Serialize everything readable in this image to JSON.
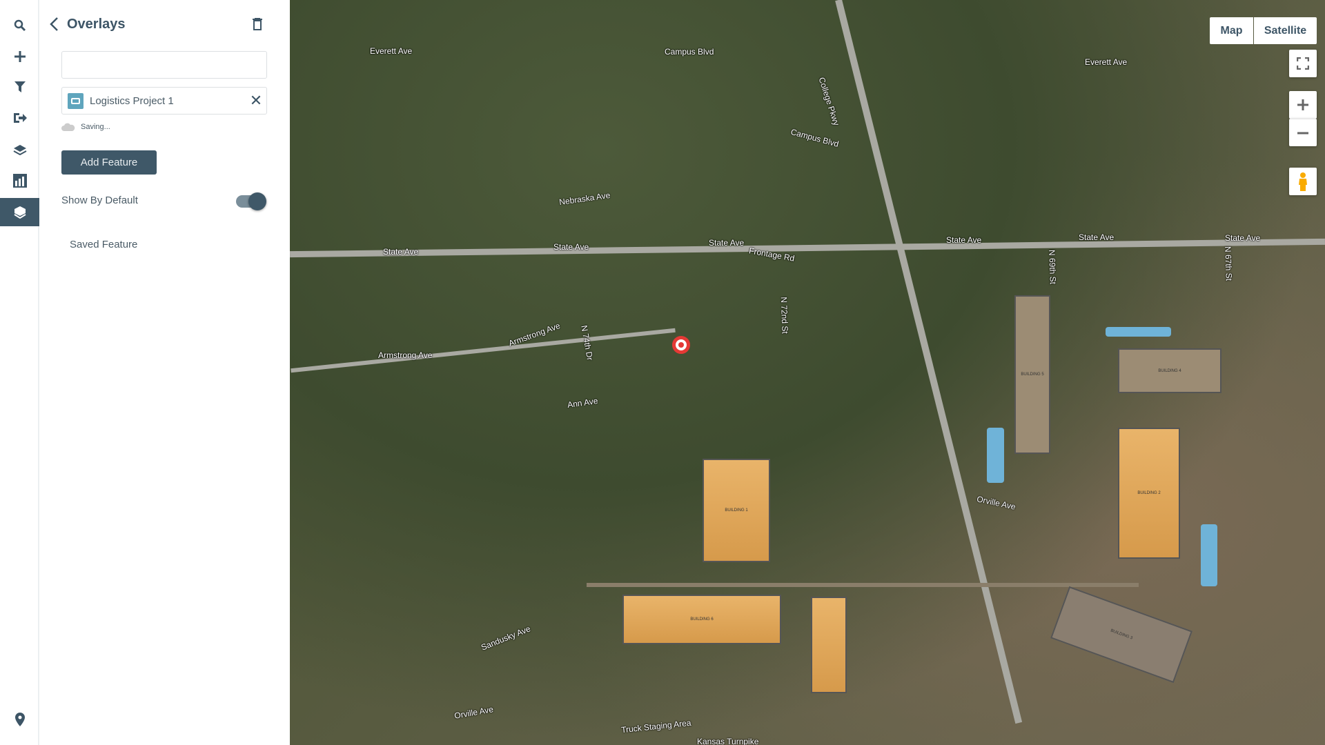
{
  "rail": {
    "items": [
      {
        "icon": "search-icon"
      },
      {
        "icon": "plus-icon"
      },
      {
        "icon": "filter-icon"
      },
      {
        "icon": "export-icon"
      },
      {
        "icon": "layers-icon"
      },
      {
        "icon": "chart-icon"
      },
      {
        "icon": "overlays-icon",
        "active": true
      }
    ],
    "bottom_icon": "location-pin-icon"
  },
  "panel": {
    "title": "Overlays",
    "search_value": "",
    "project": {
      "name": "Logistics Project 1"
    },
    "status": "Saving...",
    "add_feature": "Add Feature",
    "show_by_default": {
      "label": "Show By Default",
      "on": true
    },
    "saved_feature": "Saved Feature"
  },
  "map": {
    "type_buttons": [
      "Map",
      "Satellite"
    ],
    "road_labels": [
      "State Ave",
      "State Ave",
      "State Ave",
      "State Ave",
      "State Ave",
      "State Ave",
      "Armstrong Ave",
      "Armstrong Ave",
      "Everett Ave",
      "Everett Ave",
      "Campus Blvd",
      "Campus Blvd",
      "College Pkwy",
      "Frontage Rd",
      "Nebraska Ave",
      "Ann Ave",
      "Orville Ave",
      "Orville Ave",
      "Sandusky Ave",
      "Truck Staging Area",
      "Kansas Turnpike",
      "N 74th Dr",
      "N 72nd St",
      "N 69th St",
      "N 67th St"
    ],
    "buildings": [
      "BUILDING 1",
      "BUILDING 2",
      "BUILDING 3",
      "BUILDING 4",
      "BUILDING 5",
      "BUILDING 6"
    ]
  },
  "colors": {
    "accent": "#3f5868",
    "text": "#4a5b66",
    "project_icon": "#5fa5bd"
  }
}
